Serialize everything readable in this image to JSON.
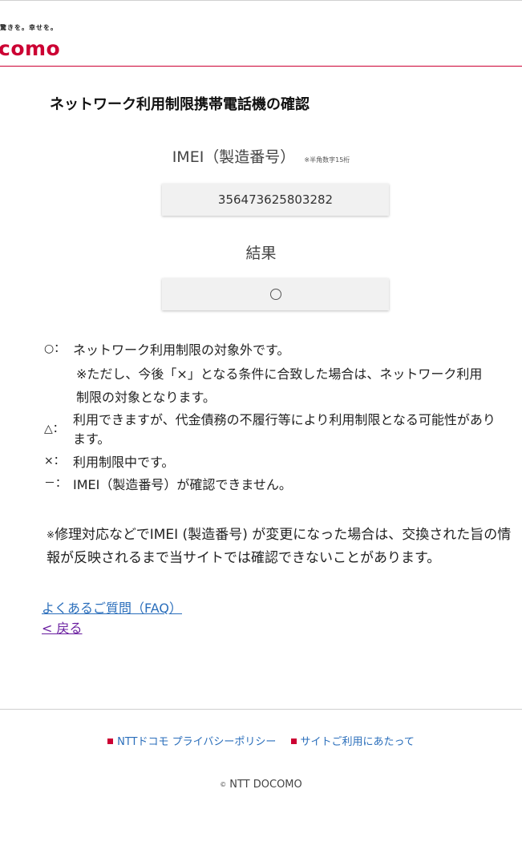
{
  "header": {
    "tagline": "驚きを。幸せを。",
    "logo": "como"
  },
  "page": {
    "title": "ネットワーク利用制限携帯電話機の確認"
  },
  "imei": {
    "label": "IMEI（製造番号）",
    "note": "※半角数字15桁",
    "value": "356473625803282"
  },
  "result": {
    "label": "結果",
    "value": "○"
  },
  "legend": [
    {
      "symbol": "○：",
      "text": "ネットワーク利用制限の対象外です。"
    },
    {
      "symbol": "",
      "text": "※ただし、今後「×」となる条件に合致した場合は、ネットワーク利用制限の対象となります。"
    },
    {
      "symbol": "△：",
      "text": "利用できますが、代金債務の不履行等により利用制限となる可能性があります。"
    },
    {
      "symbol": "×：",
      "text": "利用制限中です。"
    },
    {
      "symbol": "－：",
      "text": "IMEI（製造番号）が確認できません。"
    }
  ],
  "footnote": {
    "mark": "※",
    "text": "修理対応などでIMEI (製造番号) が変更になった場合は、交換された旨の情報が反映されるまで当サイトでは確認できないことがあります。"
  },
  "links": {
    "faq": "よくあるご質問（FAQ）",
    "back": "< 戻る"
  },
  "footer": {
    "privacy": "NTTドコモ プライバシーポリシー",
    "terms": "サイトご利用にあたって",
    "copyright_mark": "©",
    "copyright": "NTT DOCOMO"
  },
  "colors": {
    "brand": "#cc0033",
    "link": "#2a6ebb",
    "visited": "#6a1fa0"
  }
}
